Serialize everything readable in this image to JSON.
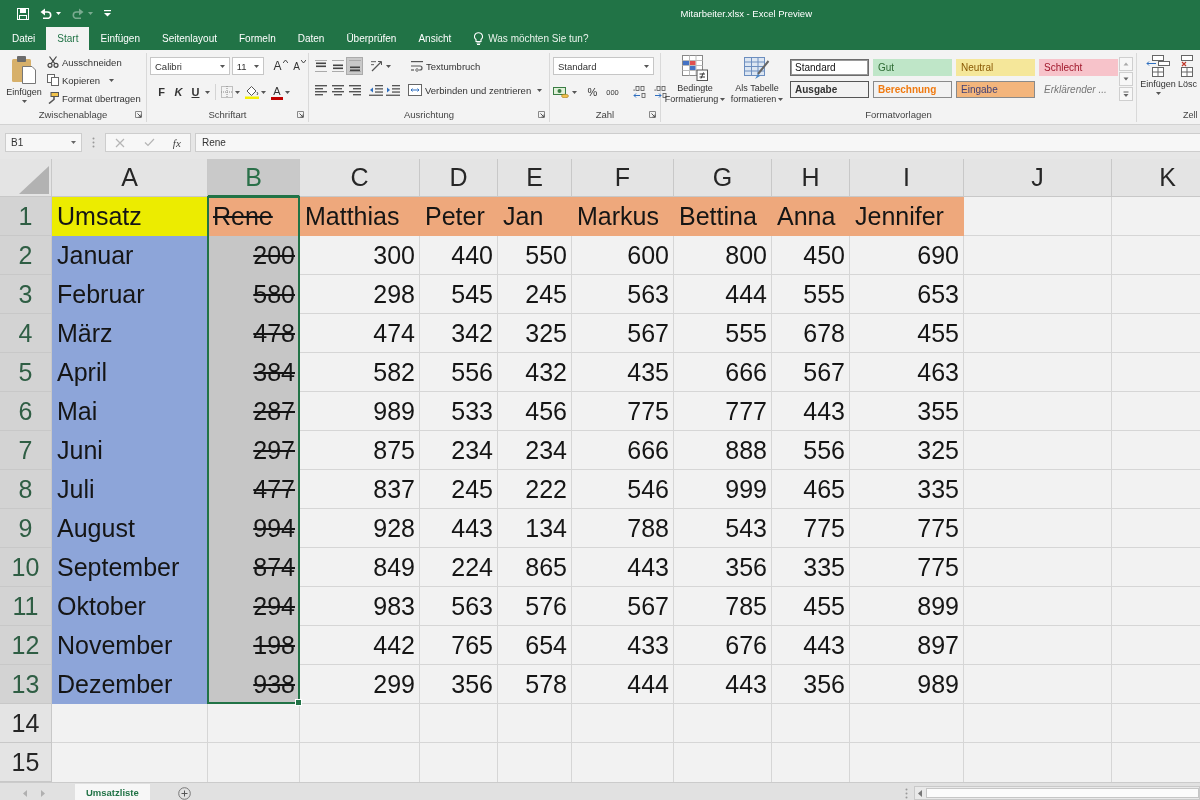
{
  "window": {
    "title": "Mitarbeiter.xlsx - Excel Preview"
  },
  "quick_access": [
    {
      "kind": "save",
      "disabled": false
    },
    {
      "kind": "undo",
      "disabled": false
    },
    {
      "kind": "redo",
      "disabled": true
    },
    {
      "kind": "customize",
      "disabled": false
    }
  ],
  "ribbon_tabs": [
    {
      "label": "Datei",
      "selected": false
    },
    {
      "label": "Start",
      "selected": true
    },
    {
      "label": "Einfügen",
      "selected": false
    },
    {
      "label": "Seitenlayout",
      "selected": false
    },
    {
      "label": "Formeln",
      "selected": false
    },
    {
      "label": "Daten",
      "selected": false
    },
    {
      "label": "Überprüfen",
      "selected": false
    },
    {
      "label": "Ansicht",
      "selected": false
    }
  ],
  "tell_me": {
    "placeholder": "Was möchten Sie tun?"
  },
  "clipboard": {
    "label": "Zwischenablage",
    "paste": "Einfügen",
    "commands": [
      {
        "kind": "cut",
        "label": "Ausschneiden"
      },
      {
        "kind": "copy",
        "label": "Kopieren"
      },
      {
        "kind": "format_painter",
        "label": "Format übertragen"
      }
    ]
  },
  "font": {
    "label": "Schriftart",
    "name": "Calibri",
    "size": "11",
    "grow": "A",
    "shrink": "A",
    "styles": [
      {
        "kind": "bold",
        "label": "F"
      },
      {
        "kind": "italic",
        "label": "K"
      },
      {
        "kind": "underline",
        "label": "U"
      }
    ],
    "font_color": "A"
  },
  "alignment": {
    "label": "Ausrichtung",
    "vertical": [
      {
        "kind": "top",
        "selected": false
      },
      {
        "kind": "middle",
        "selected": false
      },
      {
        "kind": "bottom",
        "selected": true
      }
    ],
    "horizontal": [
      {
        "kind": "left",
        "selected": false
      },
      {
        "kind": "center",
        "selected": false
      },
      {
        "kind": "right",
        "selected": false
      }
    ],
    "wrap": "Textumbruch",
    "merge": "Verbinden und zentrieren"
  },
  "number": {
    "label": "Zahl",
    "format": "Standard",
    "percent": "%",
    "thousands": "000"
  },
  "styles": {
    "label": "Formatvorlagen",
    "conditional": "Bedingte Formatierung",
    "as_table": "Als Tabelle formatieren",
    "gallery": [
      {
        "kind": "normal",
        "label": "Standard",
        "selected": true
      },
      {
        "kind": "good",
        "label": "Gut",
        "selected": false
      },
      {
        "kind": "neutral",
        "label": "Neutral",
        "selected": false
      },
      {
        "kind": "bad",
        "label": "Schlecht",
        "selected": false
      },
      {
        "kind": "output",
        "label": "Ausgabe",
        "selected": false
      },
      {
        "kind": "calculation",
        "label": "Berechnung",
        "selected": false
      },
      {
        "kind": "input",
        "label": "Eingabe",
        "selected": false
      },
      {
        "kind": "explanatory",
        "label": "Erklärender ...",
        "selected": false
      }
    ]
  },
  "cells": {
    "label": "Zell",
    "insert": "Einfügen",
    "delete": "Lösc"
  },
  "formula_bar": {
    "name_box": "B1",
    "function": "fx",
    "content": "Rene"
  },
  "sheet": {
    "columns": [
      {
        "label": "A",
        "selected": false,
        "strikethrough": false
      },
      {
        "label": "B",
        "selected": true,
        "strikethrough": true
      },
      {
        "label": "C",
        "selected": false,
        "strikethrough": false
      },
      {
        "label": "D",
        "selected": false,
        "strikethrough": false
      },
      {
        "label": "E",
        "selected": false,
        "strikethrough": false
      },
      {
        "label": "F",
        "selected": false,
        "strikethrough": false
      },
      {
        "label": "G",
        "selected": false,
        "strikethrough": false
      },
      {
        "label": "H",
        "selected": false,
        "strikethrough": false
      },
      {
        "label": "I",
        "selected": false,
        "strikethrough": false
      },
      {
        "label": "J",
        "selected": false
      },
      {
        "label": "K",
        "selected": false
      }
    ],
    "rows": [
      {
        "number": "1",
        "highlighted": true,
        "cells": [
          {
            "kind": "text",
            "text": "Umsatz",
            "color": "#ecec00"
          },
          {
            "kind": "text",
            "text": "Rene",
            "color": "#eea87c"
          },
          {
            "kind": "text",
            "text": "Matthias",
            "color": "#eea87c"
          },
          {
            "kind": "text",
            "text": "Peter",
            "color": "#eea87c"
          },
          {
            "kind": "text",
            "text": "Jan",
            "color": "#eea87c"
          },
          {
            "kind": "text",
            "text": "Markus",
            "color": "#eea87c"
          },
          {
            "kind": "text",
            "text": "Bettina",
            "color": "#eea87c"
          },
          {
            "kind": "text",
            "text": "Anna",
            "color": "#eea87c"
          },
          {
            "kind": "text",
            "text": "Jennifer",
            "color": "#eea87c"
          }
        ]
      },
      {
        "number": "2",
        "highlighted": true,
        "cells": [
          {
            "kind": "text",
            "text": "Januar",
            "color": "#8da5d9"
          },
          {
            "kind": "number",
            "text": "200"
          },
          {
            "kind": "number",
            "text": "300"
          },
          {
            "kind": "number",
            "text": "440"
          },
          {
            "kind": "number",
            "text": "550"
          },
          {
            "kind": "number",
            "text": "600"
          },
          {
            "kind": "number",
            "text": "800"
          },
          {
            "kind": "number",
            "text": "450"
          },
          {
            "kind": "number",
            "text": "690"
          }
        ]
      },
      {
        "number": "3",
        "highlighted": true,
        "cells": [
          {
            "kind": "text",
            "text": "Februar",
            "color": "#8da5d9"
          },
          {
            "kind": "number",
            "text": "580"
          },
          {
            "kind": "number",
            "text": "298"
          },
          {
            "kind": "number",
            "text": "545"
          },
          {
            "kind": "number",
            "text": "245"
          },
          {
            "kind": "number",
            "text": "563"
          },
          {
            "kind": "number",
            "text": "444"
          },
          {
            "kind": "number",
            "text": "555"
          },
          {
            "kind": "number",
            "text": "653"
          }
        ]
      },
      {
        "number": "4",
        "highlighted": true,
        "cells": [
          {
            "kind": "text",
            "text": "März",
            "color": "#8da5d9"
          },
          {
            "kind": "number",
            "text": "478"
          },
          {
            "kind": "number",
            "text": "474"
          },
          {
            "kind": "number",
            "text": "342"
          },
          {
            "kind": "number",
            "text": "325"
          },
          {
            "kind": "number",
            "text": "567"
          },
          {
            "kind": "number",
            "text": "555"
          },
          {
            "kind": "number",
            "text": "678"
          },
          {
            "kind": "number",
            "text": "455"
          }
        ]
      },
      {
        "number": "5",
        "highlighted": true,
        "cells": [
          {
            "kind": "text",
            "text": "April",
            "color": "#8da5d9"
          },
          {
            "kind": "number",
            "text": "384"
          },
          {
            "kind": "number",
            "text": "582"
          },
          {
            "kind": "number",
            "text": "556"
          },
          {
            "kind": "number",
            "text": "432"
          },
          {
            "kind": "number",
            "text": "435"
          },
          {
            "kind": "number",
            "text": "666"
          },
          {
            "kind": "number",
            "text": "567"
          },
          {
            "kind": "number",
            "text": "463"
          }
        ]
      },
      {
        "number": "6",
        "highlighted": true,
        "cells": [
          {
            "kind": "text",
            "text": "Mai",
            "color": "#8da5d9"
          },
          {
            "kind": "number",
            "text": "287"
          },
          {
            "kind": "number",
            "text": "989"
          },
          {
            "kind": "number",
            "text": "533"
          },
          {
            "kind": "number",
            "text": "456"
          },
          {
            "kind": "number",
            "text": "775"
          },
          {
            "kind": "number",
            "text": "777"
          },
          {
            "kind": "number",
            "text": "443"
          },
          {
            "kind": "number",
            "text": "355"
          }
        ]
      },
      {
        "number": "7",
        "highlighted": true,
        "cells": [
          {
            "kind": "text",
            "text": "Juni",
            "color": "#8da5d9"
          },
          {
            "kind": "number",
            "text": "297"
          },
          {
            "kind": "number",
            "text": "875"
          },
          {
            "kind": "number",
            "text": "234"
          },
          {
            "kind": "number",
            "text": "234"
          },
          {
            "kind": "number",
            "text": "666"
          },
          {
            "kind": "number",
            "text": "888"
          },
          {
            "kind": "number",
            "text": "556"
          },
          {
            "kind": "number",
            "text": "325"
          }
        ]
      },
      {
        "number": "8",
        "highlighted": true,
        "cells": [
          {
            "kind": "text",
            "text": "Juli",
            "color": "#8da5d9"
          },
          {
            "kind": "number",
            "text": "477"
          },
          {
            "kind": "number",
            "text": "837"
          },
          {
            "kind": "number",
            "text": "245"
          },
          {
            "kind": "number",
            "text": "222"
          },
          {
            "kind": "number",
            "text": "546"
          },
          {
            "kind": "number",
            "text": "999"
          },
          {
            "kind": "number",
            "text": "465"
          },
          {
            "kind": "number",
            "text": "335"
          }
        ]
      },
      {
        "number": "9",
        "highlighted": true,
        "cells": [
          {
            "kind": "text",
            "text": "August",
            "color": "#8da5d9"
          },
          {
            "kind": "number",
            "text": "994"
          },
          {
            "kind": "number",
            "text": "928"
          },
          {
            "kind": "number",
            "text": "443"
          },
          {
            "kind": "number",
            "text": "134"
          },
          {
            "kind": "number",
            "text": "788"
          },
          {
            "kind": "number",
            "text": "543"
          },
          {
            "kind": "number",
            "text": "775"
          },
          {
            "kind": "number",
            "text": "775"
          }
        ]
      },
      {
        "number": "10",
        "highlighted": true,
        "cells": [
          {
            "kind": "text",
            "text": "September",
            "color": "#8da5d9"
          },
          {
            "kind": "number",
            "text": "874"
          },
          {
            "kind": "number",
            "text": "849"
          },
          {
            "kind": "number",
            "text": "224"
          },
          {
            "kind": "number",
            "text": "865"
          },
          {
            "kind": "number",
            "text": "443"
          },
          {
            "kind": "number",
            "text": "356"
          },
          {
            "kind": "number",
            "text": "335"
          },
          {
            "kind": "number",
            "text": "775"
          }
        ]
      },
      {
        "number": "11",
        "highlighted": true,
        "cells": [
          {
            "kind": "text",
            "text": "Oktober",
            "color": "#8da5d9"
          },
          {
            "kind": "number",
            "text": "294"
          },
          {
            "kind": "number",
            "text": "983"
          },
          {
            "kind": "number",
            "text": "563"
          },
          {
            "kind": "number",
            "text": "576"
          },
          {
            "kind": "number",
            "text": "567"
          },
          {
            "kind": "number",
            "text": "785"
          },
          {
            "kind": "number",
            "text": "455"
          },
          {
            "kind": "number",
            "text": "899"
          }
        ]
      },
      {
        "number": "12",
        "highlighted": true,
        "cells": [
          {
            "kind": "text",
            "text": "November",
            "color": "#8da5d9"
          },
          {
            "kind": "number",
            "text": "198"
          },
          {
            "kind": "number",
            "text": "442"
          },
          {
            "kind": "number",
            "text": "765"
          },
          {
            "kind": "number",
            "text": "654"
          },
          {
            "kind": "number",
            "text": "433"
          },
          {
            "kind": "number",
            "text": "676"
          },
          {
            "kind": "number",
            "text": "443"
          },
          {
            "kind": "number",
            "text": "897"
          }
        ]
      },
      {
        "number": "13",
        "highlighted": true,
        "cells": [
          {
            "kind": "text",
            "text": "Dezember",
            "color": "#8da5d9"
          },
          {
            "kind": "number",
            "text": "938"
          },
          {
            "kind": "number",
            "text": "299"
          },
          {
            "kind": "number",
            "text": "356"
          },
          {
            "kind": "number",
            "text": "578"
          },
          {
            "kind": "number",
            "text": "444"
          },
          {
            "kind": "number",
            "text": "443"
          },
          {
            "kind": "number",
            "text": "356"
          },
          {
            "kind": "number",
            "text": "989"
          }
        ]
      },
      {
        "number": "14",
        "highlighted": false
      },
      {
        "number": "15",
        "highlighted": false
      }
    ]
  },
  "sheet_tabs": [
    {
      "label": "Umsatzliste",
      "selected": true
    }
  ]
}
